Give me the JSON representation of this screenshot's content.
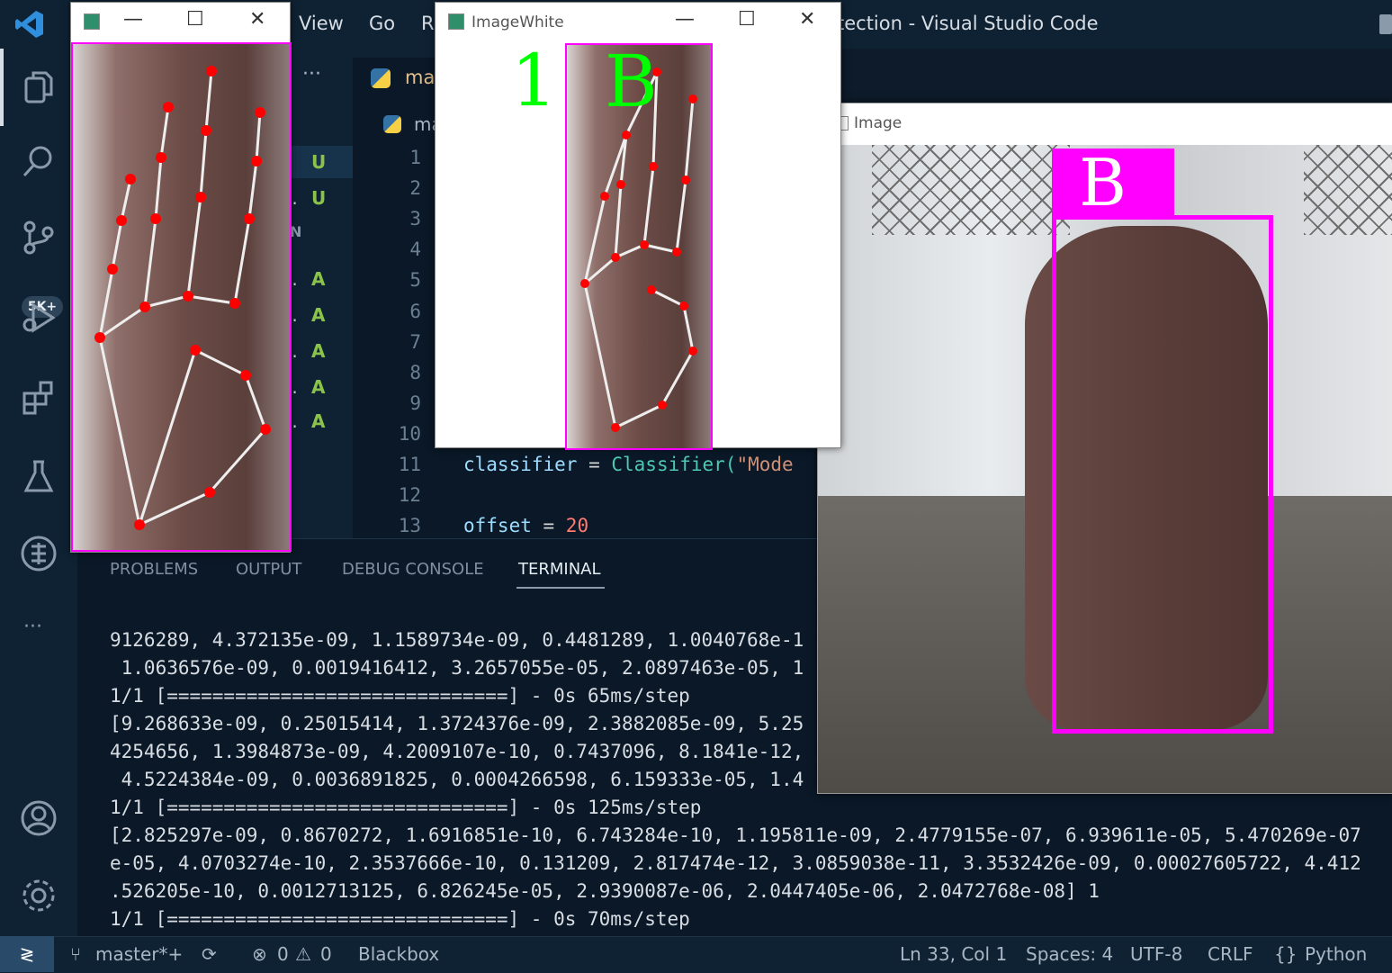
{
  "menu": [
    "View",
    "Go",
    "R"
  ],
  "window_title": "tection - Visual Studio Code",
  "activity": {
    "badge": "5K+"
  },
  "sidebar": {
    "tab": "ma",
    "tab2": "ma",
    "items": [
      {
        "status": "U",
        "prefix": ""
      },
      {
        "status": "U",
        "prefix": ".."
      },
      {
        "status": "N",
        "prefix": ""
      },
      {
        "status": "A",
        "prefix": ".."
      },
      {
        "status": "A",
        "prefix": ".."
      },
      {
        "status": "A",
        "prefix": ".."
      },
      {
        "status": "A",
        "prefix": ".."
      },
      {
        "status": "A",
        "prefix": ".."
      }
    ],
    "more": "···"
  },
  "editor": {
    "line_numbers": [
      "1",
      "2",
      "3",
      "4",
      "5",
      "6",
      "7",
      "8",
      "9",
      "10",
      "11",
      "12",
      "13"
    ],
    "line11": {
      "a": "classifier",
      "op": " = ",
      "b": "Classifier(",
      "s": "\"Mode"
    },
    "line13": {
      "a": "offset",
      "op": " = ",
      "n": "20"
    }
  },
  "panel": {
    "tabs": [
      "PROBLEMS",
      "OUTPUT",
      "DEBUG CONSOLE",
      "TERMINAL"
    ],
    "active_tab": "TERMINAL",
    "terminal_lines": [
      "9126289, 4.372135e-09, 1.1589734e-09, 0.4481289, 1.0040768e-1",
      " 1.0636576e-09, 0.0019416412, 3.2657055e-05, 2.0897463e-05, 1",
      "1/1 [==============================] - 0s 65ms/step",
      "[9.268633e-09, 0.25015414, 1.3724376e-09, 2.3882085e-09, 5.25",
      "4254656, 1.3984873e-09, 4.2009107e-10, 0.7437096, 8.1841e-12,",
      " 4.5224384e-09, 0.0036891825, 0.0004266598, 6.159333e-05, 1.4",
      "1/1 [==============================] - 0s 125ms/step",
      "[2.825297e-09, 0.8670272, 1.6916851e-10, 6.743284e-10, 1.195811e-09, 2.4779155e-07, 6.939611e-05, 5.470269e-07",
      "e-05, 4.0703274e-10, 2.3537666e-10, 0.131209, 2.817474e-12, 3.0859038e-11, 3.3532426e-09, 0.00027605722, 4.412",
      ".526205e-10, 0.0012713125, 6.826245e-05, 2.9390087e-06, 2.0447405e-06, 2.0472768e-08] 1",
      "1/1 [==============================] - 0s 70ms/step"
    ]
  },
  "status": {
    "branch": "master*+",
    "errors": "0",
    "warnings": "0",
    "extension": "Blackbox",
    "cursor": "Ln 33, Col 1",
    "spaces": "Spaces: 4",
    "encoding": "UTF-8",
    "eol": "CRLF",
    "language": "Python"
  },
  "windows": {
    "image_white": {
      "title": "ImageWhite",
      "count_label": "1",
      "letter": "B"
    },
    "image": {
      "title": "Image",
      "letter": "B"
    }
  },
  "colors": {
    "accent_magenta": "#ff00ff",
    "landmark_green": "#00ff00",
    "point_red": "#ff0000"
  }
}
